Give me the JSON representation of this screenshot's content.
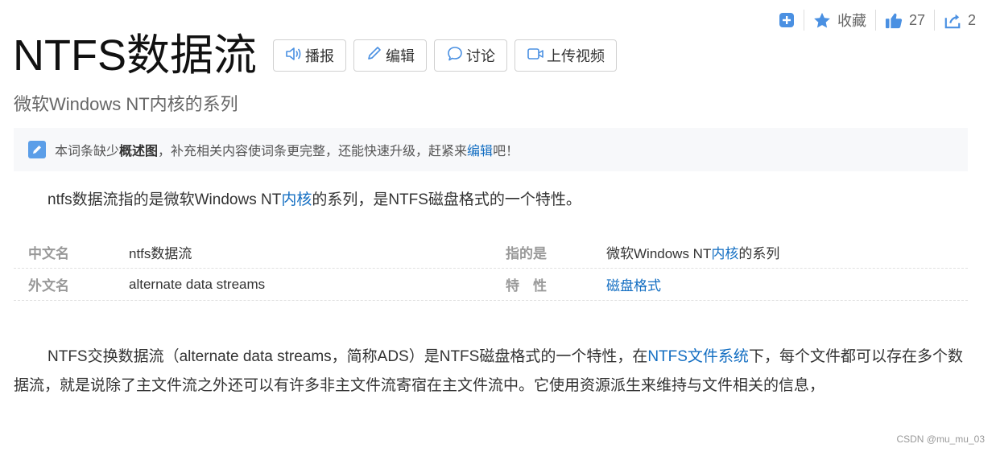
{
  "toolbar": {
    "favorite_label": "收藏",
    "like_count": "27",
    "share_count": "2"
  },
  "header": {
    "title": "NTFS数据流",
    "buttons": {
      "broadcast": "播报",
      "edit": "编辑",
      "discuss": "讨论",
      "upload_video": "上传视频"
    },
    "subtitle": "微软Windows NT内核的系列"
  },
  "notice": {
    "prefix": "本词条缺少",
    "bold": "概述图",
    "middle": "，补充相关内容使词条更完整，还能快速升级，赶紧来",
    "link": "编辑",
    "suffix": "吧！"
  },
  "intro": {
    "prefix": "ntfs数据流指的是微软Windows NT",
    "link": "内核",
    "suffix": "的系列，是NTFS磁盘格式的一个特性。"
  },
  "info": {
    "row1": {
      "k1": "中文名",
      "v1": "ntfs数据流",
      "k2": "指的是",
      "v2_prefix": "微软Windows NT",
      "v2_link": "内核",
      "v2_suffix": "的系列"
    },
    "row2": {
      "k1": "外文名",
      "v1": "alternate data streams",
      "k2": "特　性",
      "v2_link": "磁盘格式"
    }
  },
  "body": {
    "prefix": "NTFS交换数据流（alternate data streams，简称ADS）是NTFS磁盘格式的一个特性，在",
    "link": "NTFS文件系统",
    "suffix": "下，每个文件都可以存在多个数据流，就是说除了主文件流之外还可以有许多非主文件流寄宿在主文件流中。它使用资源派生来维持与文件相关的信息，"
  },
  "watermark": "CSDN @mu_mu_03",
  "colors": {
    "accent": "#4a90e2",
    "link": "#136ec2"
  }
}
